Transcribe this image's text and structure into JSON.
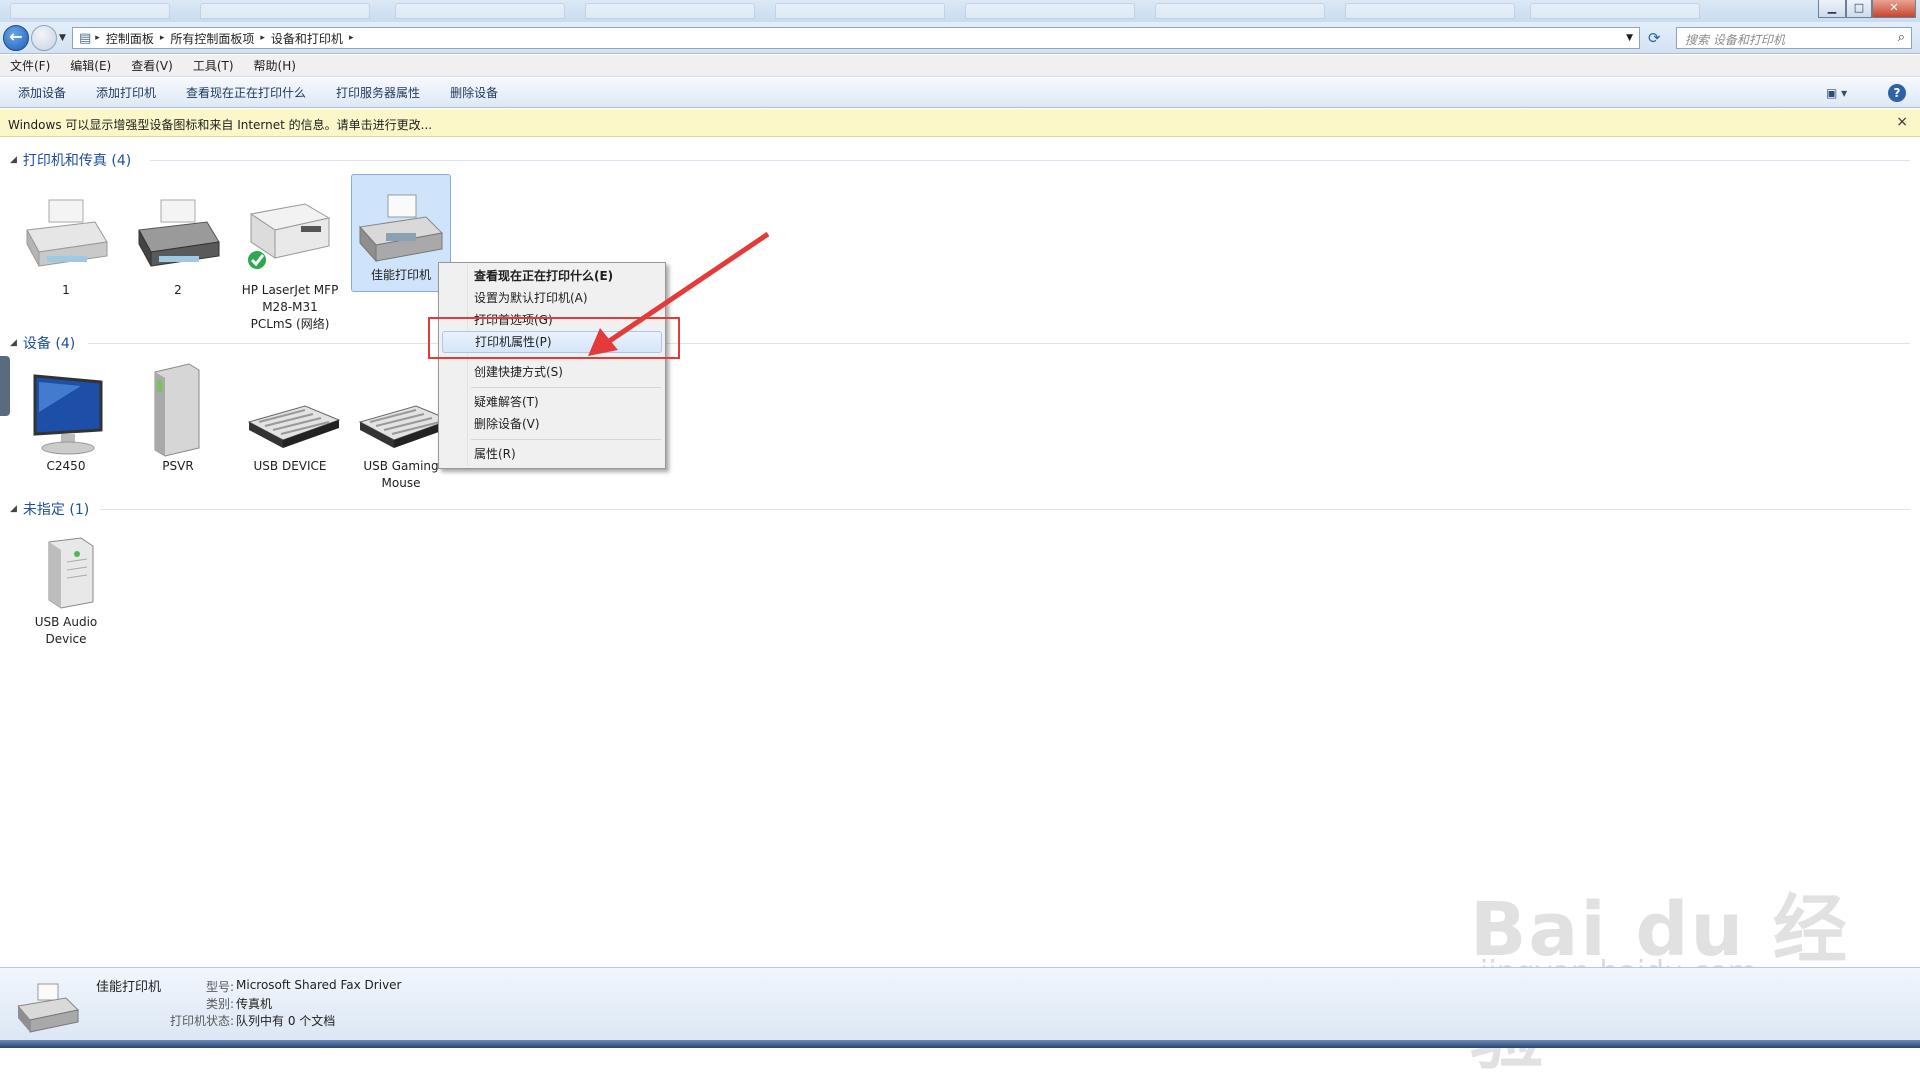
{
  "address": {
    "crumbs": [
      "控制面板",
      "所有控制面板项",
      "设备和打印机"
    ],
    "search_placeholder": "搜索 设备和打印机"
  },
  "menubar": {
    "items": [
      "文件(F)",
      "编辑(E)",
      "查看(V)",
      "工具(T)",
      "帮助(H)"
    ]
  },
  "commandbar": {
    "items": [
      "添加设备",
      "添加打印机",
      "查看现在正在打印什么",
      "打印服务器属性",
      "删除设备"
    ],
    "help": "?"
  },
  "infobar": {
    "text": "Windows 可以显示增强型设备图标和来自 Internet 的信息。请单击进行更改...",
    "close": "×"
  },
  "groups": {
    "printers": {
      "title": "打印机和传真 (4)",
      "items": [
        "1",
        "2",
        "HP LaserJet MFP M28-M31 PCLmS (网络)",
        "佳能打印机"
      ]
    },
    "devices": {
      "title": "设备 (4)",
      "items": [
        "C2450",
        "PSVR",
        "USB DEVICE",
        "USB Gaming Mouse"
      ]
    },
    "unspecified": {
      "title": "未指定 (1)",
      "items": [
        "USB Audio Device"
      ]
    }
  },
  "context_menu": {
    "items": [
      "查看现在正在打印什么(E)",
      "设置为默认打印机(A)",
      "打印首选项(G)",
      "打印机属性(P)",
      "创建快捷方式(S)",
      "疑难解答(T)",
      "删除设备(V)",
      "属性(R)"
    ]
  },
  "details": {
    "name": "佳能打印机",
    "model_label": "型号:",
    "model_value": "Microsoft Shared Fax Driver",
    "category_label": "类别:",
    "category_value": "传真机",
    "status_label": "打印机状态:",
    "status_value": "队列中有 0 个文档"
  },
  "watermark": {
    "line1": "Bai du 经验",
    "line2": "jingyan.baidu.com"
  },
  "colors": {
    "highlight_box": "#e53a3a",
    "arrow": "#e53a3a",
    "group_title": "#1e4e9c"
  }
}
